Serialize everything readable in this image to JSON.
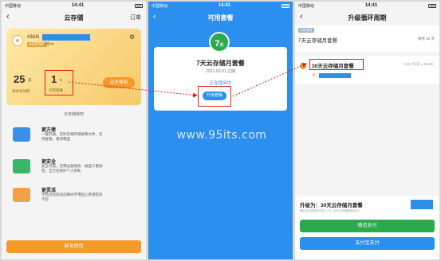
{
  "status_bar": {
    "carrier": "中国移动",
    "time": "14:41"
  },
  "phone1": {
    "nav": {
      "title": "云存储",
      "right": "订单"
    },
    "card": {
      "device_name": "43AN",
      "trial_tag": "7天云存储",
      "trial_text": "试用中",
      "days_value": "25",
      "days_unit": "天",
      "days_label": "剩余有效期",
      "package_count": "1",
      "package_unit": "个",
      "package_label": "可用套餐 ›",
      "extend_label": "延长使用"
    },
    "privileges_title": "云存储特权",
    "privileges": [
      {
        "title": "更方便",
        "desc": "一键开通，实时云端存储录像文件，支持查看，看到哪里"
      },
      {
        "title": "更安全",
        "desc": "安全可靠，无惧设备受损、被盗三重加密，全方位保护个人隐私"
      },
      {
        "title": "更灵活",
        "desc": "不错过任何动态瞬间不用担心存储空间不足"
      }
    ],
    "bottom_button": "延长使用"
  },
  "phone2": {
    "nav": {
      "title": "可用套餐"
    },
    "badge": {
      "num": "7",
      "unit": "天"
    },
    "title": "7天云存储月套餐",
    "expire": "2021-03-01 过期",
    "in_use": "正在使用中",
    "upgrade_button": "升级套餐",
    "watermark": "www.95its.com"
  },
  "phone3": {
    "nav": {
      "title": "升级循环周期"
    },
    "current_tag": "当前套餐",
    "current_name": "7天云存储月套餐",
    "current_remain": "剩余 25 天",
    "option_name": "30天云存储月套餐",
    "option_price": "¥",
    "option_old_price": "0.02 元/天 = ¥6.00",
    "upgrade_to": "升级为：30天云存储月套餐",
    "terms": "确认支付即表示同意《TP-LINK云存储服务协议》",
    "wechat_pay": "微信支付",
    "alipay": "支付宝支付"
  },
  "colors": {
    "accent_orange": "#f39a2a",
    "accent_blue": "#2b8ff0",
    "accent_green": "#2aaa4d",
    "highlight_red": "#e02020"
  }
}
